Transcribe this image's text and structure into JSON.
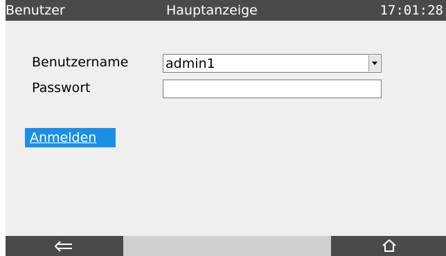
{
  "header": {
    "left_title": "Benutzer",
    "center_title": "Hauptanzeige",
    "clock": "17:01:28"
  },
  "form": {
    "username_label": "Benutzername",
    "username_value": "admin1",
    "password_label": "Passwort",
    "password_value": ""
  },
  "actions": {
    "login_label": "Anmelden"
  },
  "footer": {
    "back_icon": "back-arrow-icon",
    "home_icon": "home-icon"
  },
  "colors": {
    "header_bg": "#4a4a4a",
    "screen_bg": "#efefef",
    "button_bg": "#1a8fe6",
    "footer_mid_bg": "#cfcfcf"
  }
}
